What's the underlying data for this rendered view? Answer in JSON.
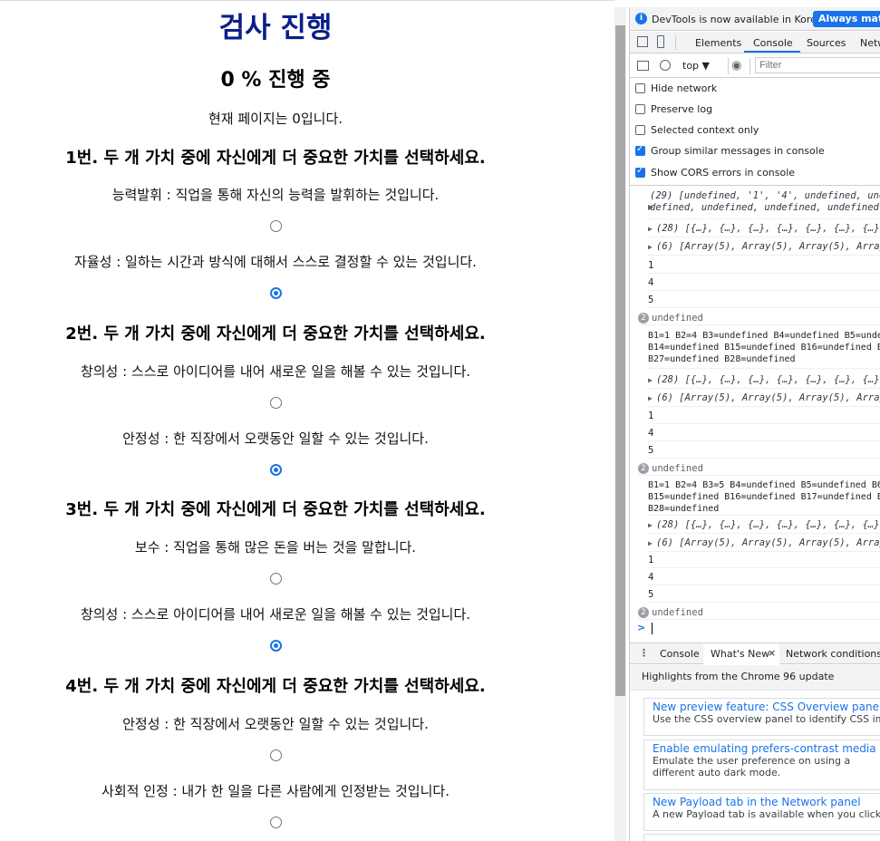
{
  "survey": {
    "title": "검사 진행",
    "progress": "0 % 진행 중",
    "current_page": "현재 페이지는 0입니다.",
    "questions": [
      {
        "text": "1번. 두 개 가치 중에 자신에게 더 중요한 가치를 선택하세요.",
        "options": [
          {
            "label": "능력발휘 : 직업을 통해 자신의 능력을 발휘하는 것입니다.",
            "checked": false
          },
          {
            "label": "자율성 : 일하는 시간과 방식에 대해서 스스로 결정할 수 있는 것입니다.",
            "checked": true
          }
        ]
      },
      {
        "text": "2번. 두 개 가치 중에 자신에게 더 중요한 가치를 선택하세요.",
        "options": [
          {
            "label": "창의성 : 스스로 아이디어를 내어 새로운 일을 해볼 수 있는 것입니다.",
            "checked": false
          },
          {
            "label": "안정성 : 한 직장에서 오랫동안 일할 수 있는 것입니다.",
            "checked": true
          }
        ]
      },
      {
        "text": "3번. 두 개 가치 중에 자신에게 더 중요한 가치를 선택하세요.",
        "options": [
          {
            "label": "보수 : 직업을 통해 많은 돈을 버는 것을 말합니다.",
            "checked": false
          },
          {
            "label": "창의성 : 스스로 아이디어를 내어 새로운 일을 해볼 수 있는 것입니다.",
            "checked": true
          }
        ]
      },
      {
        "text": "4번. 두 개 가치 중에 자신에게 더 중요한 가치를 선택하세요.",
        "options": [
          {
            "label": "안정성 : 한 직장에서 오랫동안 일할 수 있는 것입니다.",
            "checked": false
          },
          {
            "label": "사회적 인정 : 내가 한 일을 다른 사람에게 인정받는 것입니다.",
            "checked": false
          }
        ]
      }
    ]
  },
  "devtools": {
    "notice": "DevTools is now available in Korean!",
    "notice_button": "Always match",
    "tabs": [
      "Elements",
      "Console",
      "Sources",
      "Netw"
    ],
    "active_tab": "Console",
    "context": "top ▼",
    "filter_placeholder": "Filter",
    "options": [
      {
        "label": "Hide network",
        "checked": false
      },
      {
        "label": "Preserve log",
        "checked": false
      },
      {
        "label": "Selected context only",
        "checked": false
      },
      {
        "label": "Group similar messages in console",
        "checked": true
      },
      {
        "label": "Show CORS errors in console",
        "checked": true
      }
    ],
    "console_lines": {
      "arr29_a": "(29) [undefined, '1', '4', undefined, unde",
      "arr29_b": "defined, undefined, undefined, undefined,",
      "obj28": "(28) [{…}, {…}, {…}, {…}, {…}, {…}, {…}, {",
      "arr6": "(6) [Array(5), Array(5), Array(5), Array(5",
      "v1": "1",
      "v4": "4",
      "v5": "5",
      "badge": "2",
      "undef": "undefined",
      "b_block1": [
        "B1=1 B2=4 B3=undefined B4=undefined B5=unde",
        "B14=undefined B15=undefined B16=undefined B",
        "B27=undefined B28=undefined"
      ],
      "b_block2": [
        "B1=1 B2=4 B3=5 B4=undefined B5=undefined B6",
        "B15=undefined B16=undefined B17=undefined B",
        "B28=undefined"
      ],
      "prompt": ">"
    },
    "drawer_tabs": [
      "Console",
      "What's New",
      "Network conditions"
    ],
    "drawer_active": "What's New",
    "highlights": "Highlights from the Chrome 96 update",
    "cards": [
      {
        "title": "New preview feature: CSS Overview panel",
        "desc": "Use the CSS overview panel to identify CSS impro"
      },
      {
        "title": "Enable emulating prefers-contrast media and",
        "desc": "Emulate the user preference on using a different auto dark mode."
      },
      {
        "title": "New Payload tab in the Network panel",
        "desc": "A new Payload tab is available when you click to i"
      }
    ]
  }
}
